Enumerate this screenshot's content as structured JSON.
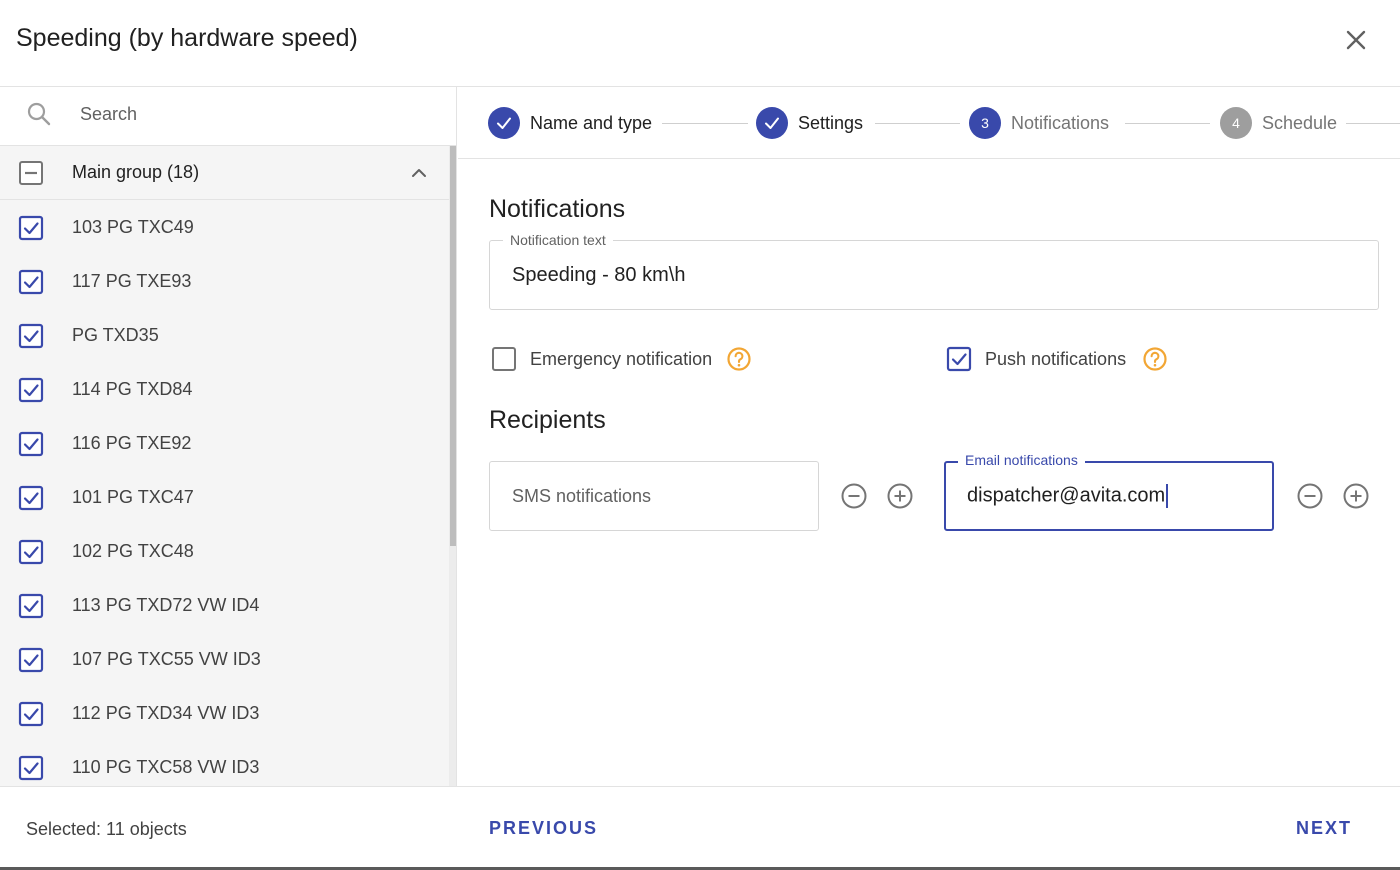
{
  "dialog": {
    "title": "Speeding (by hardware speed)",
    "close_icon": "close-icon"
  },
  "sidebar": {
    "search": {
      "placeholder": "Search",
      "value": ""
    },
    "group": {
      "label": "Main group  (18)",
      "state": "partial",
      "expanded": true
    },
    "items": [
      {
        "label": "103 PG TXC49",
        "checked": true
      },
      {
        "label": "117 PG TXE93",
        "checked": true
      },
      {
        "label": "PG TXD35",
        "checked": true
      },
      {
        "label": "114 PG TXD84",
        "checked": true
      },
      {
        "label": "116 PG TXE92",
        "checked": true
      },
      {
        "label": "101 PG TXC47",
        "checked": true
      },
      {
        "label": "102 PG TXC48",
        "checked": true
      },
      {
        "label": "113 PG TXD72 VW ID4",
        "checked": true
      },
      {
        "label": "107 PG TXC55 VW ID3",
        "checked": true
      },
      {
        "label": "112 PG TXD34 VW ID3",
        "checked": true
      },
      {
        "label": "110 PG TXC58 VW ID3",
        "checked": true
      }
    ]
  },
  "stepper": {
    "steps": [
      {
        "label": "Name and type",
        "state": "done",
        "number": ""
      },
      {
        "label": "Settings",
        "state": "done",
        "number": ""
      },
      {
        "label": "Notifications",
        "state": "active",
        "number": "3"
      },
      {
        "label": "Schedule",
        "state": "pending",
        "number": "4"
      }
    ]
  },
  "notifications": {
    "section_title": "Notifications",
    "text_field": {
      "legend": "Notification text",
      "value": "Speeding - 80 km\\h"
    },
    "emergency": {
      "label": "Emergency notification",
      "checked": false
    },
    "push": {
      "label": "Push notifications",
      "checked": true
    }
  },
  "recipients": {
    "section_title": "Recipients",
    "sms": {
      "placeholder": "SMS notifications",
      "value": ""
    },
    "email": {
      "legend": "Email notifications",
      "value": "dispatcher@avita.com"
    }
  },
  "footer": {
    "selected_text": "Selected: 11 objects",
    "previous_label": "PREVIOUS",
    "next_label": "NEXT"
  },
  "colors": {
    "accent": "#3949ab",
    "help": "#f2a634",
    "pending": "#9e9e9e",
    "checkbox": "#3949ab"
  }
}
